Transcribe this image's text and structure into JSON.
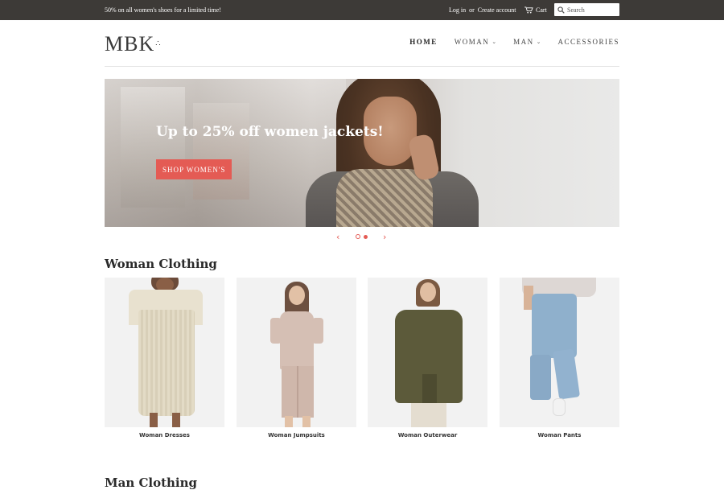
{
  "topbar": {
    "announcement": "50% on all women's shoes for a limited time!",
    "login": "Log in",
    "or": "or",
    "create_account": "Create account",
    "cart": "Cart",
    "search_placeholder": "Search"
  },
  "header": {
    "logo": "MBK",
    "nav": [
      {
        "label": "HOME",
        "active": true,
        "dropdown": false
      },
      {
        "label": "WOMAN",
        "active": false,
        "dropdown": true
      },
      {
        "label": "MAN",
        "active": false,
        "dropdown": true
      },
      {
        "label": "ACCESSORIES",
        "active": false,
        "dropdown": false
      }
    ]
  },
  "hero": {
    "headline": "Up to 25% off women jackets!",
    "cta_label": "SHOP WOMEN'S",
    "slide_count": 2,
    "active_slide": 1
  },
  "sections": {
    "woman_title": "Woman Clothing",
    "man_title": "Man Clothing"
  },
  "collections": [
    {
      "label": "Woman Dresses"
    },
    {
      "label": "Woman Jumpsuits"
    },
    {
      "label": "Woman Outerwear"
    },
    {
      "label": "Woman Pants"
    }
  ],
  "colors": {
    "topbar_bg": "#3d3a37",
    "accent": "#e45b54"
  },
  "icons": {
    "cart": "cart-icon",
    "search": "search-icon",
    "prev": "chevron-left-icon",
    "next": "chevron-right-icon"
  }
}
